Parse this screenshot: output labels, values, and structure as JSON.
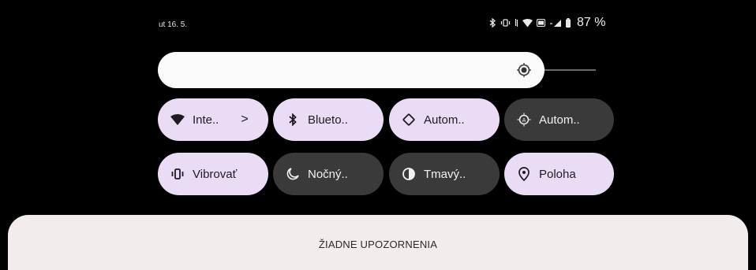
{
  "status_bar": {
    "date": "ut 16. 5.",
    "battery_percent": "87 %",
    "icons": [
      "bluetooth-icon",
      "vibrate-icon",
      "data-icon",
      "wifi-icon",
      "volte-icon",
      "signal-icon",
      "battery-icon"
    ]
  },
  "brightness": {
    "icon": "brightness-icon",
    "level": 0.8
  },
  "tiles": [
    {
      "label": "Inte..",
      "icon": "wifi-icon",
      "state": "on",
      "has_chevron": true
    },
    {
      "label": "Blueto..",
      "icon": "bluetooth-icon",
      "state": "on"
    },
    {
      "label": "Autom..",
      "icon": "auto-rotate-icon",
      "state": "on"
    },
    {
      "label": "Autom..",
      "icon": "auto-brightness-icon",
      "state": "off"
    },
    {
      "label": "Vibrovať",
      "icon": "vibrate-icon",
      "state": "on"
    },
    {
      "label": "Nočný..",
      "icon": "night-mode-icon",
      "state": "off"
    },
    {
      "label": "Tmavý..",
      "icon": "dark-theme-icon",
      "state": "off"
    },
    {
      "label": "Poloha",
      "icon": "location-icon",
      "state": "on"
    }
  ],
  "notifications": {
    "empty_text": "ŽIADNE UPOZORNENIA"
  },
  "colors": {
    "background": "#000000",
    "tile_on": "#eadcf5",
    "tile_off": "#3a3a3a",
    "panel": "#f3ecec"
  }
}
